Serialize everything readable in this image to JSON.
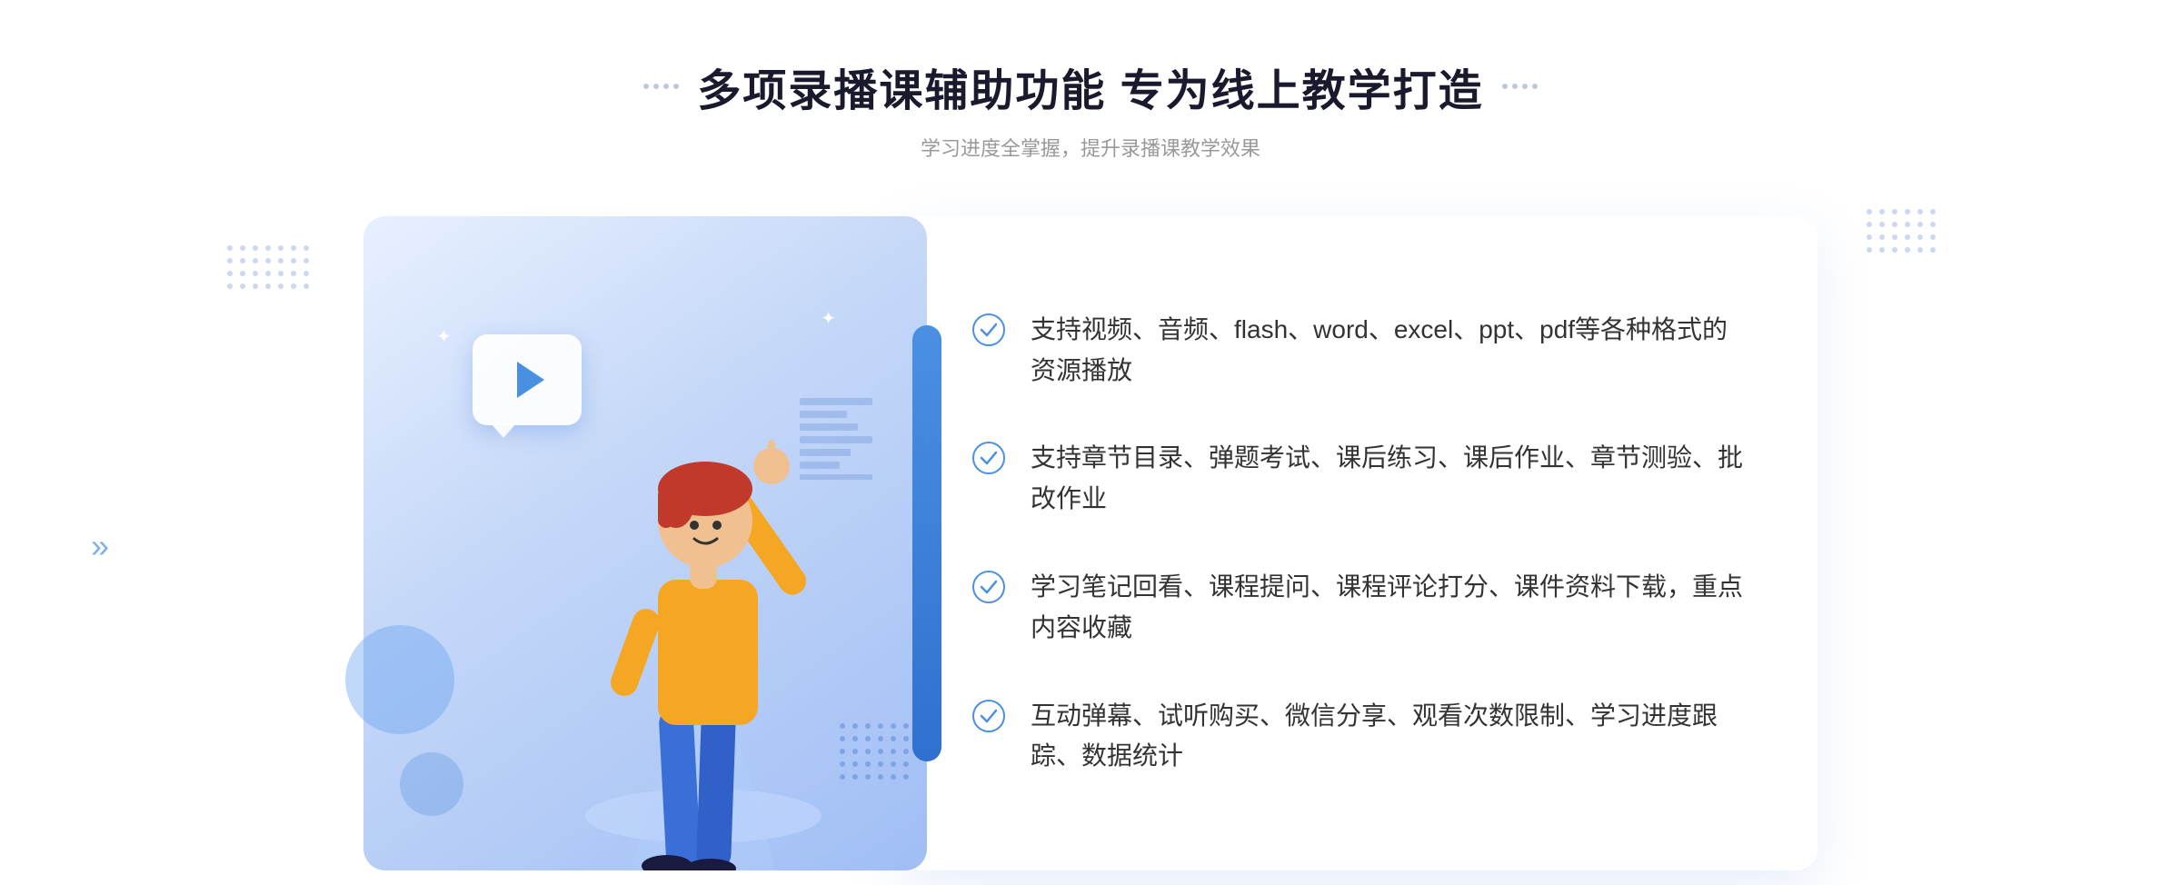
{
  "header": {
    "title": "多项录播课辅助功能 专为线上教学打造",
    "subtitle": "学习进度全掌握，提升录播课教学效果",
    "deco_dots_count": 4
  },
  "features": [
    {
      "id": 1,
      "text": "支持视频、音频、flash、word、excel、ppt、pdf等各种格式的资源播放"
    },
    {
      "id": 2,
      "text": "支持章节目录、弹题考试、课后练习、课后作业、章节测验、批改作业"
    },
    {
      "id": 3,
      "text": "学习笔记回看、课程提问、课程评论打分、课件资料下载，重点内容收藏"
    },
    {
      "id": 4,
      "text": "互动弹幕、试听购买、微信分享、观看次数限制、学习进度跟踪、数据统计"
    }
  ],
  "colors": {
    "primary_blue": "#4a90e2",
    "dark_blue": "#1a2a5e",
    "light_blue_bg": "#e8f0ff",
    "text_dark": "#333333",
    "text_gray": "#999999"
  },
  "chevron_symbol": "»",
  "check_symbol": "✓"
}
